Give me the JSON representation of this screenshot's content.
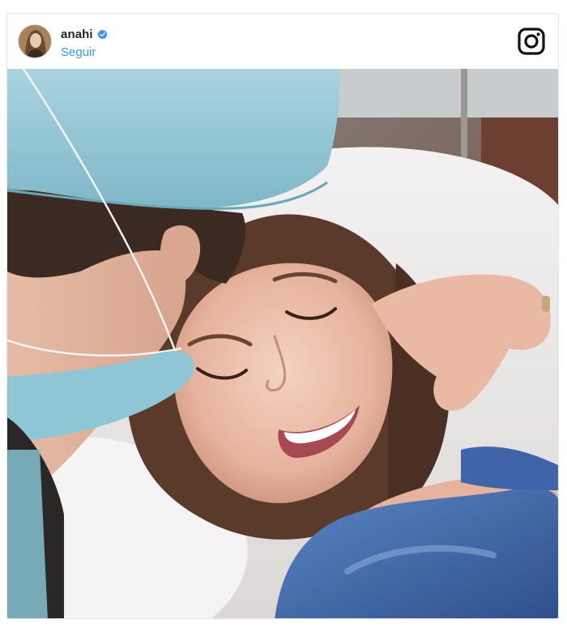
{
  "post": {
    "username": "anahi",
    "verified": true,
    "follow_label": "Seguir"
  },
  "icons": {
    "verified": "verified-badge-icon",
    "brand": "instagram-icon"
  },
  "colors": {
    "link": "#3897f0",
    "verified": "#3897f0",
    "text": "#262626",
    "border": "#e6e6e6"
  }
}
